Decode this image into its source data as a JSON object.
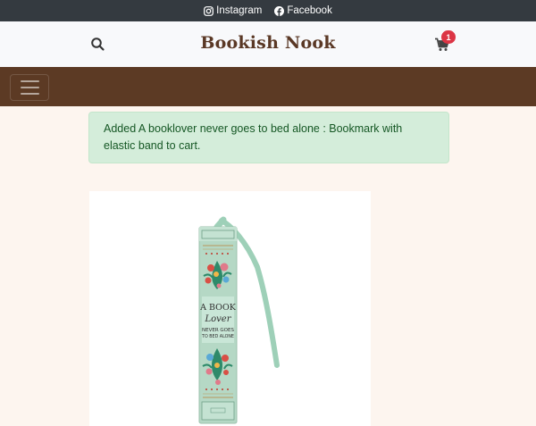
{
  "topbar": {
    "links": [
      {
        "label": "Instagram",
        "icon": "instagram-icon"
      },
      {
        "label": "Facebook",
        "icon": "facebook-icon"
      }
    ]
  },
  "header": {
    "brand": "Bookish Nook",
    "cart_count": "1",
    "icons": {
      "search": "search-icon",
      "cart": "cart-icon"
    }
  },
  "navbar": {
    "toggler_icon": "hamburger-icon"
  },
  "alert": {
    "message": "Added A booklover never goes to bed alone : Bookmark with elastic band to cart."
  },
  "product": {
    "image": {
      "line1": "A BOOK",
      "line2": "Lover",
      "line3": "NEVER GOES",
      "line4": "TO BED ALONE"
    }
  },
  "colors": {
    "topbar_bg": "#343a40",
    "header_bg": "#f8f9fb",
    "brand_text": "#5a3825",
    "navbar_bg": "#5c3a24",
    "page_bg": "#fdf5ef",
    "alert_bg": "#d4edda",
    "alert_text": "#155724",
    "badge_bg": "#dc3545",
    "bookmark_mint": "#b5d8c5"
  }
}
